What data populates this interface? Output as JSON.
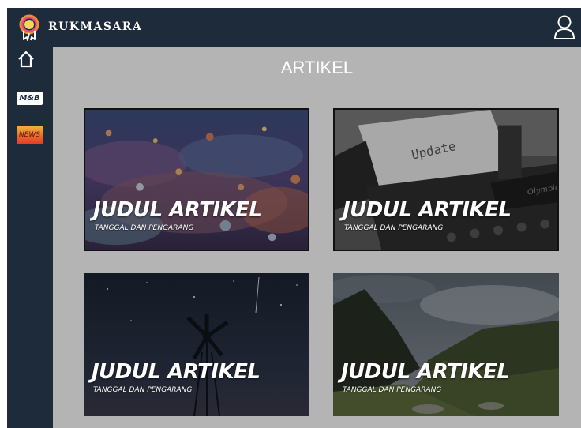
{
  "app": {
    "brand": "RUKMASARA",
    "logo_icon": "ring-logo-icon",
    "user_icon": "user-icon"
  },
  "sidebar": {
    "items": [
      {
        "icon": "home-icon",
        "label": ""
      },
      {
        "icon": "mb-badge",
        "label": "M&B"
      },
      {
        "icon": "news-badge",
        "label": "NEWS"
      }
    ]
  },
  "main": {
    "title": "ARTIKEL",
    "articles": [
      {
        "title": "JUDUL ARTIKEL",
        "meta": "TANGGAL DAN PENGARANG",
        "image": "coral-reef-image"
      },
      {
        "title": "JUDUL ARTIKEL",
        "meta": "TANGGAL DAN PENGARANG",
        "image": "typewriter-update-image"
      },
      {
        "title": "JUDUL ARTIKEL",
        "meta": "TANGGAL DAN PENGARANG",
        "image": "windmill-night-sky-image"
      },
      {
        "title": "JUDUL ARTIKEL",
        "meta": "TANGGAL DAN PENGARANG",
        "image": "mountain-valley-image"
      }
    ],
    "typewriter_paper_text": "Update",
    "typewriter_brand_text": "Olympia"
  },
  "colors": {
    "navy": "#1e2b3b",
    "content_bg": "#b4b4b4",
    "white": "#ffffff"
  }
}
